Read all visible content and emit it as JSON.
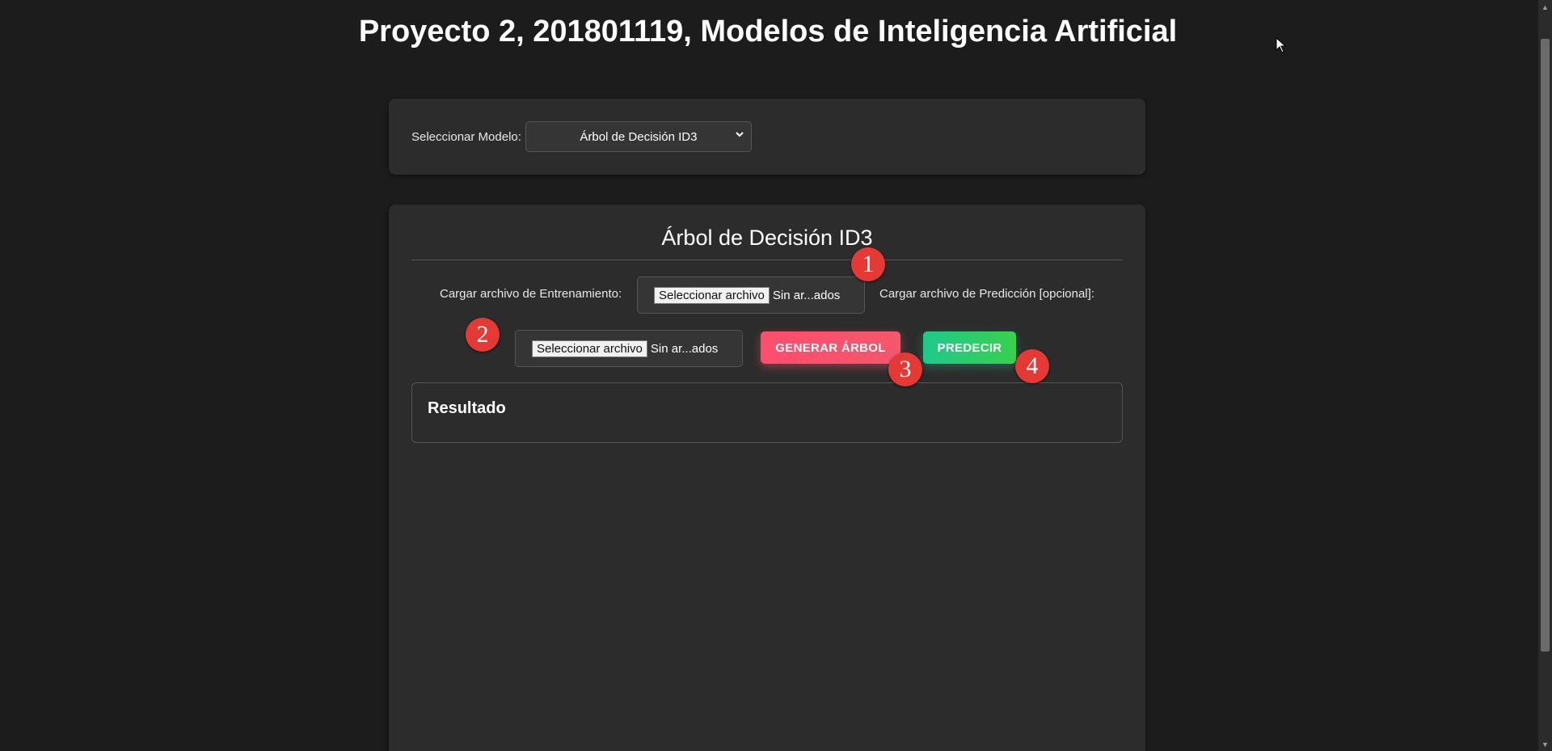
{
  "header": {
    "title": "Proyecto 2, 201801119, Modelos de Inteligencia Artificial"
  },
  "model_selector": {
    "label": "Seleccionar Modelo:",
    "selected": "Árbol de Decisión ID3"
  },
  "main": {
    "section_title": "Árbol de Decisión ID3",
    "training_label": "Cargar archivo de Entrenamiento:",
    "training_file": {
      "button_label": "Seleccionar archivo",
      "status": "Sin ar...ados"
    },
    "prediction_label": "Cargar archivo de Predicción [opcional]:",
    "prediction_file": {
      "button_label": "Seleccionar archivo",
      "status": "Sin ar...ados"
    },
    "generate_button": "GENERAR ÁRBOL",
    "predict_button": "PREDECIR",
    "result_title": "Resultado"
  },
  "annotations": [
    "1",
    "2",
    "3",
    "4"
  ],
  "colors": {
    "background": "#1c1c1c",
    "card": "#2c2c2c",
    "generate_button": "#ff4d6d",
    "predict_button": "#1fc98c",
    "badge": "#e53935"
  },
  "icons": {
    "select_chevron": "chevron-down-icon",
    "cursor": "mouse-cursor-icon"
  }
}
